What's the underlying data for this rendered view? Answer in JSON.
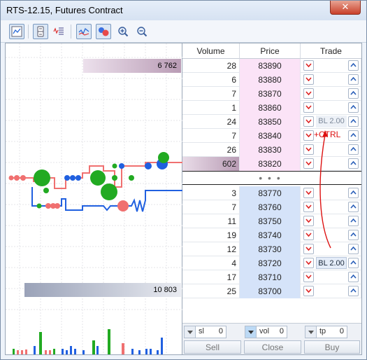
{
  "window": {
    "title": "RTS-12.15, Futures Contract",
    "close_label": "✕"
  },
  "toolbar": {
    "icons": [
      "chart-icon",
      "book-icon",
      "list-icon",
      "trades-icon",
      "circles-icon",
      "zoom-in-icon",
      "zoom-out-icon"
    ]
  },
  "ladder": {
    "headers": {
      "volume": "Volume",
      "price": "Price",
      "trade": "Trade"
    },
    "asks": [
      {
        "volume": "28",
        "price": "83890"
      },
      {
        "volume": "6",
        "price": "83880"
      },
      {
        "volume": "7",
        "price": "83870"
      },
      {
        "volume": "1",
        "price": "83860"
      },
      {
        "volume": "24",
        "price": "83850",
        "order": "BL 2.00"
      },
      {
        "volume": "7",
        "price": "83840"
      },
      {
        "volume": "26",
        "price": "83830"
      },
      {
        "volume": "602",
        "price": "83820"
      }
    ],
    "mid_dots": "• • •",
    "bids": [
      {
        "volume": "3",
        "price": "83770"
      },
      {
        "volume": "7",
        "price": "83760"
      },
      {
        "volume": "11",
        "price": "83750"
      },
      {
        "volume": "19",
        "price": "83740"
      },
      {
        "volume": "12",
        "price": "83730"
      },
      {
        "volume": "4",
        "price": "83720",
        "order": "BL 2.00"
      },
      {
        "volume": "17",
        "price": "83710"
      },
      {
        "volume": "25",
        "price": "83700"
      }
    ],
    "annotation": "+CTRL",
    "ask_color": "#fbe3f7",
    "bid_color": "#d5e3f9"
  },
  "chart": {
    "ask_total": "6 762",
    "bid_total": "10 803",
    "ask_line_color": "#f07070",
    "bid_line_color": "#2060e0"
  },
  "controls": {
    "sl": {
      "label": "sl",
      "value": "0"
    },
    "vol": {
      "label": "vol",
      "value": "0"
    },
    "tp": {
      "label": "tp",
      "value": "0"
    },
    "sell_label": "Sell",
    "close_label": "Close",
    "buy_label": "Buy"
  }
}
